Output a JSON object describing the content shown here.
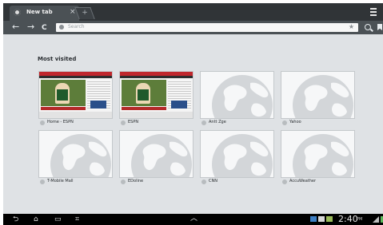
{
  "browser": {
    "tab": {
      "title": "New tab",
      "close_glyph": "×"
    },
    "new_tab_glyph": "+",
    "nav": {
      "back": "←",
      "forward": "→",
      "reload": "C"
    },
    "omnibox": {
      "placeholder": "Search",
      "value": ""
    },
    "star_glyph": "★"
  },
  "content": {
    "section_title": "Most visited",
    "tiles": [
      {
        "label": "Home - ESPN",
        "thumbnail": "espn-page"
      },
      {
        "label": "ESPN",
        "thumbnail": "espn-page"
      },
      {
        "label": "Antt Zge",
        "thumbnail": "globe-placeholder"
      },
      {
        "label": "Yahoo",
        "thumbnail": "globe-placeholder"
      },
      {
        "label": "T-Mobile Mall",
        "thumbnail": "globe-placeholder"
      },
      {
        "label": "EDoline",
        "thumbnail": "globe-placeholder"
      },
      {
        "label": "CNN",
        "thumbnail": "globe-placeholder"
      },
      {
        "label": "AccuWeather",
        "thumbnail": "globe-placeholder"
      }
    ]
  },
  "system_bar": {
    "time": "2:40",
    "ampm": "PM",
    "nav": {
      "back": "⮌",
      "home": "⌂",
      "recent": "▭",
      "screenshot": "⌗",
      "up": "︿"
    }
  },
  "colors": {
    "tabstrip": "#303437",
    "toolbar": "#4b5155",
    "content_bg": "#dfe2e5",
    "system_bar": "#000000"
  }
}
